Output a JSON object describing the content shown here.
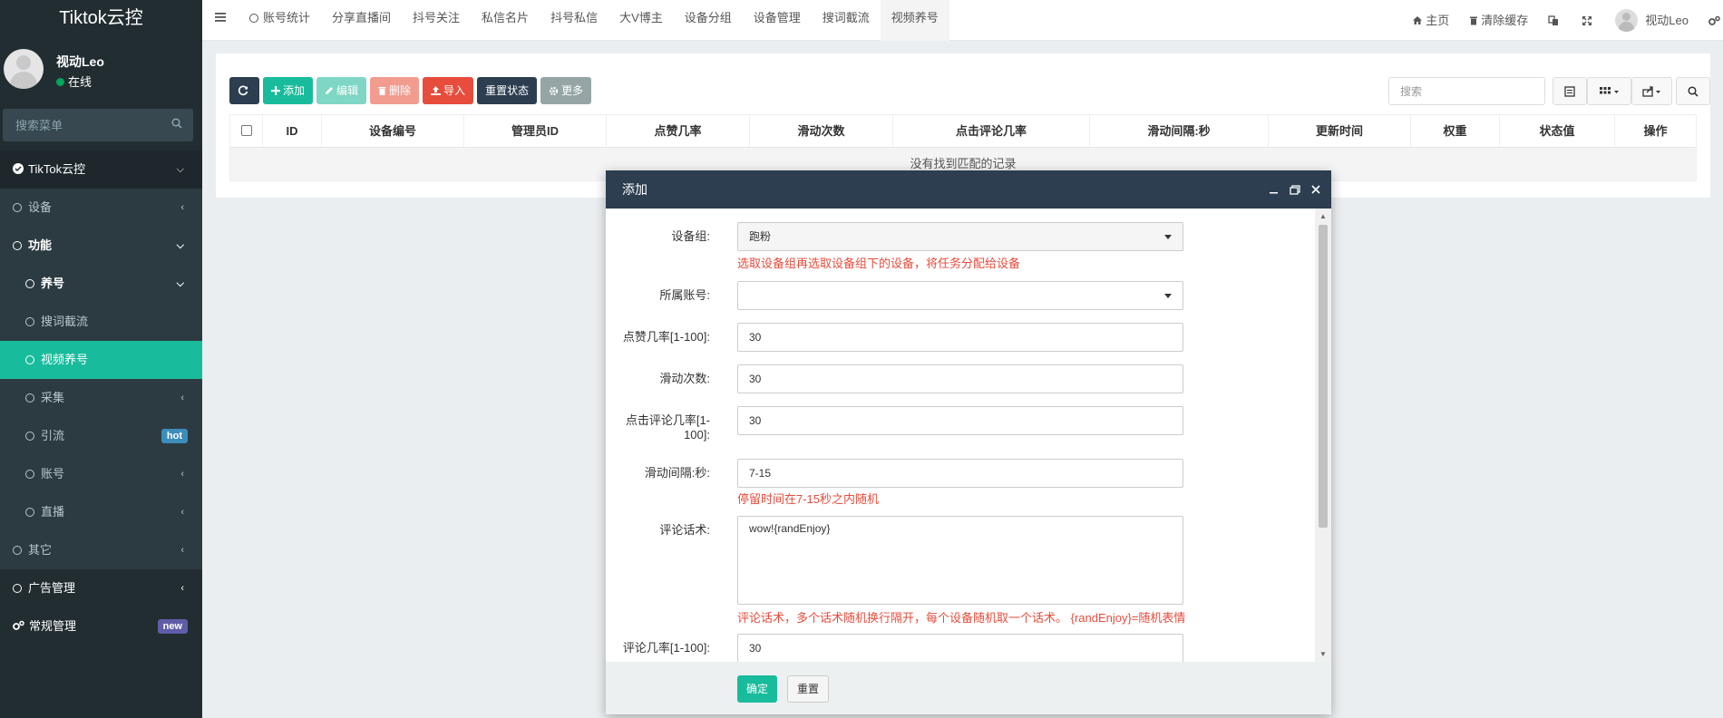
{
  "app": {
    "title": "Tiktok云控"
  },
  "user": {
    "name": "视动Leo",
    "status": "在线"
  },
  "sidebar": {
    "search_placeholder": "搜索菜单",
    "items": [
      {
        "label": "TikTok云控"
      },
      {
        "label": "设备"
      },
      {
        "label": "功能"
      },
      {
        "label": "养号"
      },
      {
        "label": "搜词截流"
      },
      {
        "label": "视频养号"
      },
      {
        "label": "采集"
      },
      {
        "label": "引流",
        "badge": "hot"
      },
      {
        "label": "账号"
      },
      {
        "label": "直播"
      },
      {
        "label": "其它"
      },
      {
        "label": "广告管理"
      },
      {
        "label": "常规管理",
        "badge": "new"
      }
    ]
  },
  "topbar": {
    "tabs": [
      "账号统计",
      "分享直播间",
      "抖号关注",
      "私信名片",
      "抖号私信",
      "大V博主",
      "设备分组",
      "设备管理",
      "搜词截流",
      "视频养号"
    ],
    "home": "主页",
    "clear_cache": "清除缓存",
    "user": "视动Leo"
  },
  "toolbar": {
    "add": "添加",
    "edit": "编辑",
    "delete": "删除",
    "import": "导入",
    "reset_status": "重置状态",
    "more": "更多",
    "search_placeholder": "搜索"
  },
  "table": {
    "columns": [
      "ID",
      "设备编号",
      "管理员ID",
      "点赞几率",
      "滑动次数",
      "点击评论几率",
      "滑动间隔:秒",
      "更新时间",
      "权重",
      "状态值",
      "操作"
    ],
    "empty": "没有找到匹配的记录"
  },
  "modal": {
    "title": "添加",
    "fields": {
      "device_group": {
        "label": "设备组:",
        "value": "跑粉",
        "help": "选取设备组再选取设备组下的设备，将任务分配给设备"
      },
      "account": {
        "label": "所属账号:",
        "value": ""
      },
      "like_rate": {
        "label": "点赞几率[1-100]:",
        "value": "30"
      },
      "swipe_count": {
        "label": "滑动次数:",
        "value": "30"
      },
      "click_comment_rate": {
        "label": "点击评论几率[1-100]:",
        "value": "30"
      },
      "swipe_interval": {
        "label": "滑动间隔:秒:",
        "value": "7-15",
        "help": "停留时间在7-15秒之内随机"
      },
      "comment_script": {
        "label": "评论话术:",
        "value": "wow!{randEnjoy}",
        "help": "评论话术，多个话术随机换行隔开，每个设备随机取一个话术。 {randEnjoy}=随机表情"
      },
      "comment_rate": {
        "label": "评论几率[1-100]:",
        "value": "30"
      }
    },
    "ok": "确定",
    "reset": "重置"
  },
  "colors": {
    "sidebar_bg": "#222d32",
    "accent": "#18bc9c",
    "header_dark": "#2c3e50",
    "danger": "#e74c3c"
  }
}
